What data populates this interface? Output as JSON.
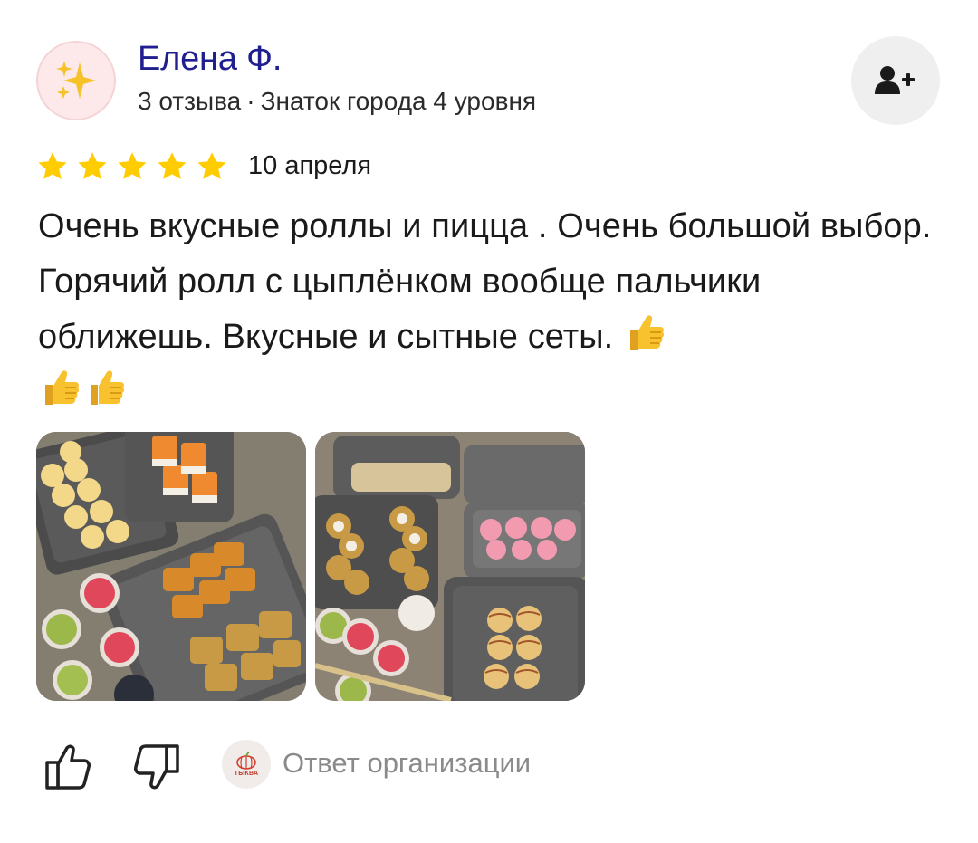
{
  "author": {
    "name": "Елена Ф.",
    "reviews_count": "3 отзыва",
    "separator": "·",
    "level": "Знаток города 4 уровня",
    "avatar_icon": "sparkles-icon"
  },
  "subscribe": {
    "icon": "add-user-icon"
  },
  "review": {
    "rating": 5,
    "rating_max": 5,
    "date": "10 апреля",
    "text": "Очень вкусные роллы и пицца . Очень большой выбор. Горячий ролл с цыплёнком вообще пальчики оближешь. Вкусные и сытные сеты.",
    "emoji": [
      "thumbs-up-emoji",
      "thumbs-up-emoji",
      "thumbs-up-emoji"
    ]
  },
  "photos": [
    {
      "name": "review-photo-1"
    },
    {
      "name": "review-photo-2"
    }
  ],
  "actions": {
    "like_icon": "thumbs-up-outline-icon",
    "dislike_icon": "thumbs-down-outline-icon",
    "org_logo_text": "ТЫКВА",
    "org_reply_label": "Ответ организации"
  },
  "colors": {
    "author_name": "#1f1f8f",
    "star": "#ffcc00",
    "muted_text": "#8a8a8a",
    "button_bg": "#efefef"
  }
}
